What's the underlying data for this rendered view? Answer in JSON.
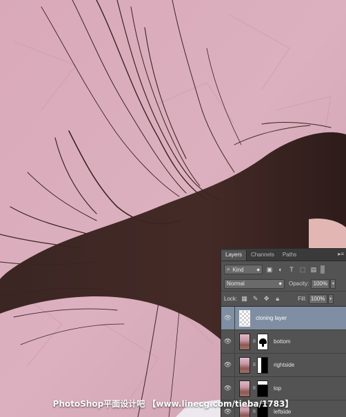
{
  "panel": {
    "tabs": [
      {
        "label": "Layers",
        "active": true
      },
      {
        "label": "Channels",
        "active": false
      },
      {
        "label": "Paths",
        "active": false
      }
    ],
    "menu_icon": "panel-menu-icon",
    "filter": {
      "kind_label": "Kind",
      "icons": [
        "pixel-filter-icon",
        "adjustment-filter-icon",
        "type-filter-icon",
        "shape-filter-icon",
        "smart-object-filter-icon"
      ]
    },
    "blend_mode": "Normal",
    "opacity_label": "Opacity:",
    "opacity_value": "100%",
    "lock_label": "Lock:",
    "lock_icons": [
      "lock-transparent-icon",
      "lock-image-icon",
      "lock-position-icon",
      "lock-all-icon"
    ],
    "fill_label": "Fill:",
    "fill_value": "100%",
    "layers": [
      {
        "name": "cloning layer",
        "selected": true,
        "has_mask": false
      },
      {
        "name": "bottom",
        "selected": false,
        "has_mask": true
      },
      {
        "name": "rightside",
        "selected": false,
        "has_mask": true
      },
      {
        "name": "top",
        "selected": false,
        "has_mask": true
      },
      {
        "name": "leftside",
        "selected": false,
        "has_mask": true
      }
    ]
  },
  "footer": {
    "text": "PhotoShop平面设计吧 【www.linecg.com/tieba/1783】"
  },
  "colors": {
    "background": "#d7a6b6",
    "hair": "#3a2422",
    "panel": "#535353",
    "selected_layer": "#7f8ea3"
  }
}
